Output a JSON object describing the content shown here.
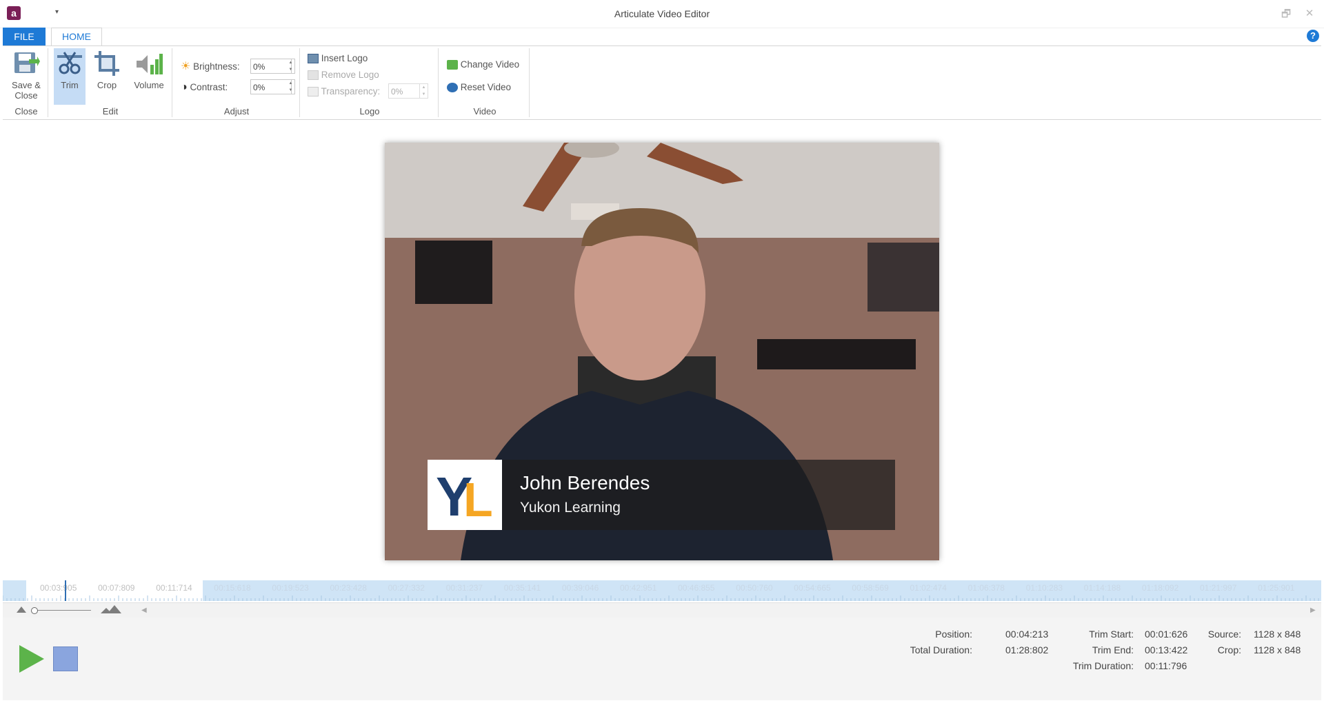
{
  "window": {
    "title": "Articulate Video Editor",
    "app_icon_letter": "a",
    "qat_arrow": "▾",
    "restore_glyph": "🗗",
    "close_glyph": "✕"
  },
  "tabs": {
    "file": "FILE",
    "home": "HOME"
  },
  "help": "?",
  "ribbon": {
    "close_group": {
      "label": "Close",
      "save_close": "Save &\nClose"
    },
    "edit_group": {
      "label": "Edit",
      "trim": "Trim",
      "crop": "Crop",
      "volume": "Volume"
    },
    "adjust_group": {
      "label": "Adjust",
      "brightness_label": "Brightness:",
      "brightness_value": "0%",
      "contrast_label": "Contrast:",
      "contrast_value": "0%"
    },
    "logo_group": {
      "label": "Logo",
      "insert_logo": "Insert Logo",
      "remove_logo": "Remove Logo",
      "transparency_label": "Transparency:",
      "transparency_value": "0%"
    },
    "video_group": {
      "label": "Video",
      "change_video": "Change Video",
      "reset_video": "Reset Video"
    }
  },
  "video": {
    "lower_third": {
      "name": "John Berendes",
      "company": "Yukon Learning",
      "logo_y": "Y",
      "logo_l": "L"
    }
  },
  "timeline": {
    "ticks": [
      "00:03:905",
      "00:07:809",
      "00:11:714",
      "00:15:618",
      "00:19:523",
      "00:23:428",
      "00:27:332",
      "00:31:237",
      "00:35:141",
      "00:39:046",
      "00:42:951",
      "00:46:855",
      "00:50:760",
      "00:54:665",
      "00:58:569",
      "01:02:474",
      "01:06:378",
      "01:10:283",
      "01:14:188",
      "01:18:092",
      "01:21:997",
      "01:25:901"
    ]
  },
  "status": {
    "position_label": "Position:",
    "position_value": "00:04:213",
    "total_duration_label": "Total Duration:",
    "total_duration_value": "01:28:802",
    "trim_start_label": "Trim Start:",
    "trim_start_value": "00:01:626",
    "trim_end_label": "Trim End:",
    "trim_end_value": "00:13:422",
    "trim_duration_label": "Trim Duration:",
    "trim_duration_value": "00:11:796",
    "source_label": "Source:",
    "source_value": "1128 x 848",
    "crop_label": "Crop:",
    "crop_value": "1128 x 848"
  },
  "colors": {
    "accent": "#1e7ad6",
    "play": "#5cb34a",
    "stop": "#8aa5de",
    "timeline": "#cfe4f6"
  }
}
